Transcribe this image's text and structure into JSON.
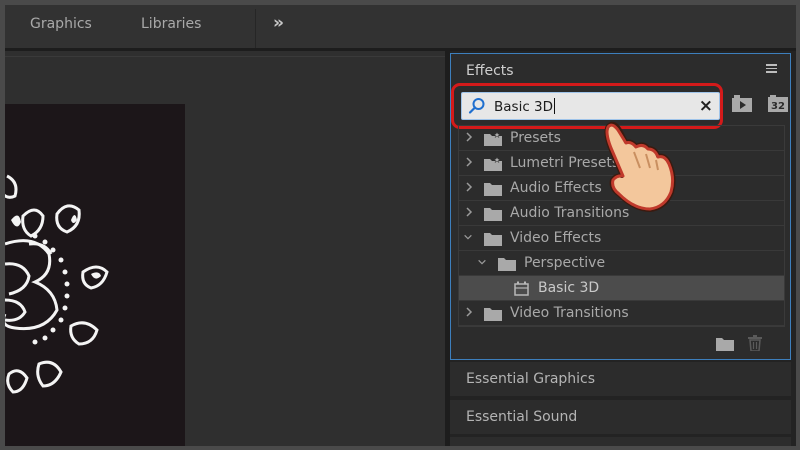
{
  "workspace": {
    "tabs": [
      {
        "label": "Graphics"
      },
      {
        "label": "Libraries"
      }
    ],
    "more_icon": "double-chevron-right-icon"
  },
  "effects_panel": {
    "title": "Effects",
    "menu_icon": "hamburger-menu-icon",
    "search": {
      "value": "Basic 3D",
      "icon": "magnifier-icon",
      "clear_icon": "close-icon"
    },
    "toolbar": {
      "accelerated_icon": "accelerated-effects-icon",
      "bit32_label": "32"
    },
    "tree": [
      {
        "label": "Presets",
        "expanded": false,
        "icon": "star-folder-icon"
      },
      {
        "label": "Lumetri Presets",
        "expanded": false,
        "icon": "star-folder-icon"
      },
      {
        "label": "Audio Effects",
        "expanded": false,
        "icon": "folder-icon"
      },
      {
        "label": "Audio Transitions",
        "expanded": false,
        "icon": "folder-icon"
      },
      {
        "label": "Video Effects",
        "expanded": true,
        "icon": "folder-icon"
      },
      {
        "label": "Perspective",
        "expanded": true,
        "icon": "folder-icon"
      },
      {
        "label": "Basic 3D",
        "selected": true,
        "icon": "effect-icon"
      },
      {
        "label": "Video Transitions",
        "expanded": false,
        "icon": "folder-icon"
      }
    ],
    "footer": {
      "new_bin_icon": "new-folder-icon",
      "delete_icon": "trash-icon"
    }
  },
  "side_panels": [
    {
      "label": "Essential Graphics"
    },
    {
      "label": "Essential Sound"
    }
  ],
  "colors": {
    "accent_blue": "#3d7fbd",
    "highlight_red": "#d41a1a",
    "selection": "#4c4c4c"
  }
}
